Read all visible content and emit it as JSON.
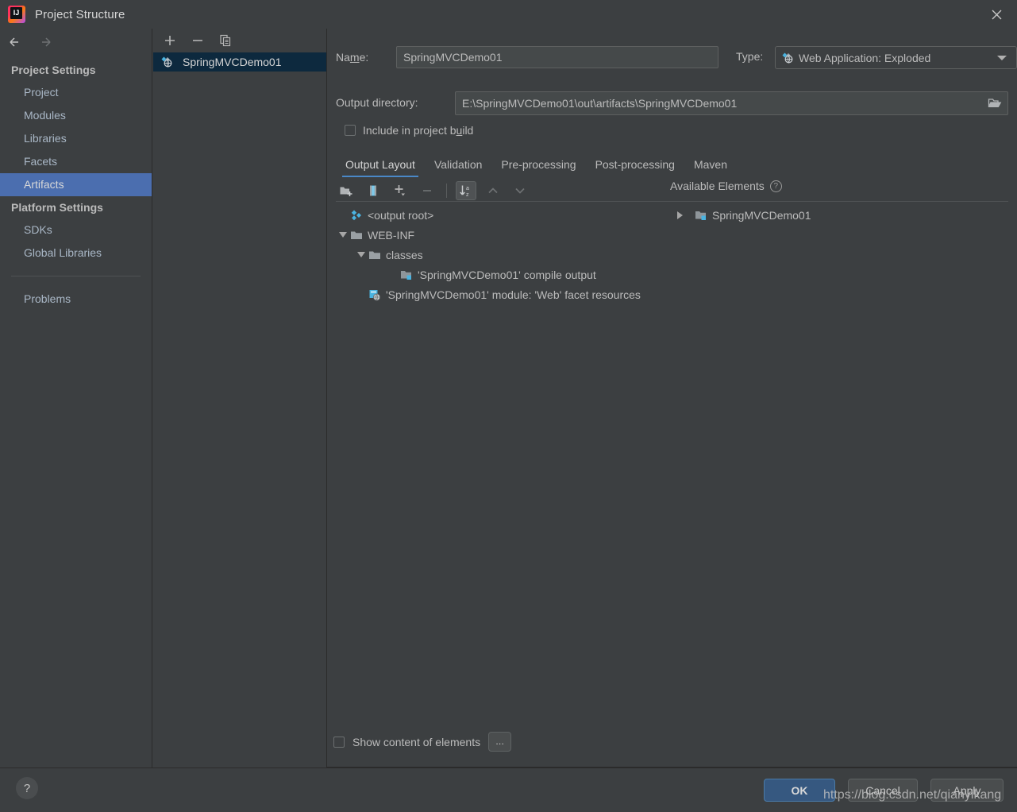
{
  "window": {
    "title": "Project Structure",
    "logo_icon": "intellij-idea-logo",
    "close_icon": "close-icon"
  },
  "sidebar": {
    "back_icon": "arrow-left-icon",
    "forward_icon": "arrow-right-icon",
    "groups": [
      {
        "title": "Project Settings",
        "items": [
          {
            "label": "Project",
            "selected": false
          },
          {
            "label": "Modules",
            "selected": false
          },
          {
            "label": "Libraries",
            "selected": false
          },
          {
            "label": "Facets",
            "selected": false
          },
          {
            "label": "Artifacts",
            "selected": true
          }
        ]
      },
      {
        "title": "Platform Settings",
        "items": [
          {
            "label": "SDKs",
            "selected": false
          },
          {
            "label": "Global Libraries",
            "selected": false
          }
        ]
      }
    ],
    "problems": {
      "label": "Problems"
    }
  },
  "artifact_list": {
    "toolbar": [
      {
        "name": "add-artifact-button",
        "icon": "plus-icon",
        "label": "+"
      },
      {
        "name": "remove-artifact-button",
        "icon": "minus-icon",
        "label": "−"
      },
      {
        "name": "copy-artifact-button",
        "icon": "copy-icon",
        "label": "copy"
      }
    ],
    "items": [
      {
        "label": "SpringMVCDemo01",
        "icon": "web-application-exploded-icon",
        "selected": true
      }
    ]
  },
  "detail": {
    "name_label": "Name:",
    "name_value": "SpringMVCDemo01",
    "type_label": "Type:",
    "type_value": "Web Application: Exploded",
    "type_icon": "web-application-exploded-icon",
    "type_dropdown_icon": "chevron-down-icon",
    "output_dir_label": "Output directory:",
    "output_dir_value": "E:\\SpringMVCDemo01\\out\\artifacts\\SpringMVCDemo01",
    "browse_icon": "folder-open-icon",
    "include_in_build_label": "Include in project build",
    "include_in_build_checked": false,
    "tabs": [
      {
        "label": "Output Layout",
        "active": true
      },
      {
        "label": "Validation",
        "active": false
      },
      {
        "label": "Pre-processing",
        "active": false
      },
      {
        "label": "Post-processing",
        "active": false
      },
      {
        "label": "Maven",
        "active": false
      }
    ],
    "layout_toolbar": [
      {
        "name": "add-directory-button",
        "icon": "folder-add-icon",
        "enabled": true,
        "pressed": false
      },
      {
        "name": "add-archive-button",
        "icon": "archive-icon",
        "enabled": true,
        "pressed": false
      },
      {
        "name": "add-element-button",
        "icon": "plus-dropdown-icon",
        "enabled": true,
        "pressed": false
      },
      {
        "name": "remove-element-button",
        "icon": "minus-icon",
        "enabled": false,
        "pressed": false
      },
      {
        "name": "sort-alphabetically-button",
        "icon": "sort-az-icon",
        "enabled": true,
        "pressed": true
      },
      {
        "name": "move-up-button",
        "icon": "arrow-up-icon",
        "enabled": false,
        "pressed": false
      },
      {
        "name": "move-down-button",
        "icon": "arrow-down-icon",
        "enabled": false,
        "pressed": false
      }
    ],
    "available_elements_label": "Available Elements",
    "available_elements_help_icon": "question-mark-icon",
    "output_tree": [
      {
        "label": "<output root>",
        "depth": 0,
        "twisty": "none",
        "icon": "output-root-icon"
      },
      {
        "label": "WEB-INF",
        "depth": 0,
        "twisty": "expanded",
        "icon": "folder-icon"
      },
      {
        "label": "classes",
        "depth": 1,
        "twisty": "expanded",
        "icon": "folder-icon"
      },
      {
        "label": "'SpringMVCDemo01' compile output",
        "depth": 2,
        "twisty": "none",
        "icon": "module-output-icon"
      },
      {
        "label": "'SpringMVCDemo01' module: 'Web' facet resources",
        "depth": 0,
        "twisty": "none",
        "icon": "web-facet-icon"
      }
    ],
    "available_tree": [
      {
        "label": "SpringMVCDemo01",
        "depth": 0,
        "twisty": "collapsed",
        "icon": "module-output-icon"
      }
    ],
    "show_content_label": "Show content of elements",
    "show_content_checked": false,
    "ellipsis_button_label": "..."
  },
  "footer": {
    "help_label": "?",
    "help_icon": "question-mark-icon",
    "buttons": [
      {
        "name": "ok-button",
        "label": "OK",
        "primary": true
      },
      {
        "name": "cancel-button",
        "label": "Cancel",
        "primary": false
      },
      {
        "name": "apply-button",
        "label": "Apply",
        "primary": false
      }
    ]
  },
  "watermark": {
    "text": "https://blog.csdn.net/qianyikang"
  },
  "colors": {
    "background": "#3c3f41",
    "selection_blue": "#4b6eaf",
    "list_selection": "#0d293e",
    "accent_tab": "#4a88c7",
    "primary_button": "#365880",
    "text": "#bbbbbb",
    "icon_cyan": "#4ab3e0"
  }
}
